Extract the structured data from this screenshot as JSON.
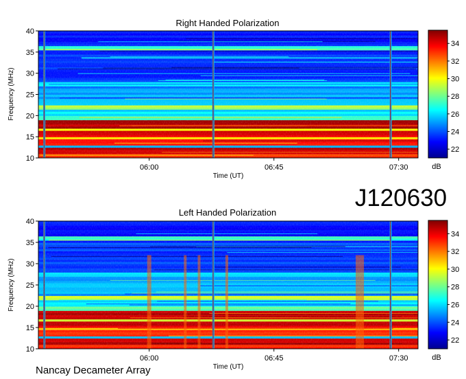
{
  "figure": {
    "event_id": "J120630",
    "instrument": "Nancay Decameter Array"
  },
  "chart_data": [
    {
      "type": "heatmap",
      "title": "Right Handed Polarization",
      "xlabel": "Time (UT)",
      "ylabel": "Frequency (MHz)",
      "x_ticks": [
        "06:00",
        "06:45",
        "07:30"
      ],
      "y_ticks": [
        10,
        15,
        20,
        25,
        30,
        35,
        40
      ],
      "ylim": [
        10,
        40
      ],
      "colorbar": {
        "label": "dB",
        "ticks": [
          22,
          24,
          26,
          28,
          30,
          32,
          34
        ],
        "range": [
          21,
          35.5
        ]
      },
      "bright_bands_mhz": [
        [
          10.5,
          19
        ],
        [
          21.5,
          22.5
        ],
        [
          27,
          27.6
        ],
        [
          35.8,
          36.5
        ]
      ],
      "vertical_events_ut": [
        "05:22",
        "06:23",
        "07:27"
      ],
      "colormap": "jet",
      "grid": false
    },
    {
      "type": "heatmap",
      "title": "Left Handed Polarization",
      "xlabel": "Time (UT)",
      "ylabel": "Frequency (MHz)",
      "x_ticks": [
        "06:00",
        "06:45",
        "07:30"
      ],
      "y_ticks": [
        10,
        15,
        20,
        25,
        30,
        35,
        40
      ],
      "ylim": [
        10,
        40
      ],
      "colorbar": {
        "label": "dB",
        "ticks": [
          22,
          24,
          26,
          28,
          30,
          32,
          34
        ],
        "range": [
          21,
          35.5
        ]
      },
      "bright_bands_mhz": [
        [
          10.5,
          19
        ],
        [
          21.5,
          22.5
        ],
        [
          27,
          27.6
        ],
        [
          35.8,
          36.5
        ]
      ],
      "vertical_events_ut": [
        "05:22",
        "06:00",
        "06:13",
        "06:18",
        "06:23",
        "06:28",
        "07:16",
        "07:27"
      ],
      "colormap": "jet",
      "grid": false
    }
  ]
}
